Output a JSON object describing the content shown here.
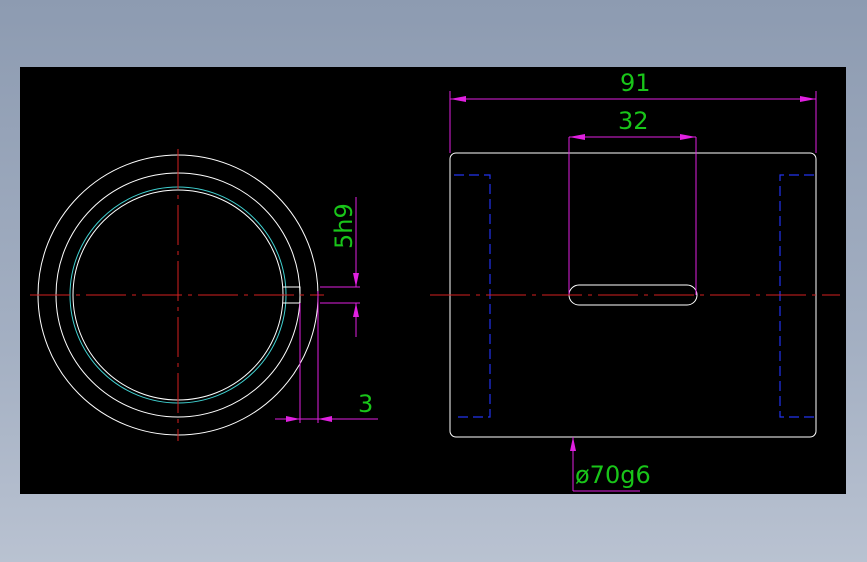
{
  "colors": {
    "background": "#000000",
    "outline": "#ffffff",
    "centerline": "#d42020",
    "dimension": "#e020e0",
    "dimension_text": "#19c519",
    "hidden_line": "#2233ee",
    "inner_ring": "#3fd0d0"
  },
  "dimensions": {
    "overall_length": "91",
    "slot_length": "32",
    "keyway_tolerance": "5h9",
    "keyway_depth": "3",
    "outer_diameter": "ø70g6"
  }
}
